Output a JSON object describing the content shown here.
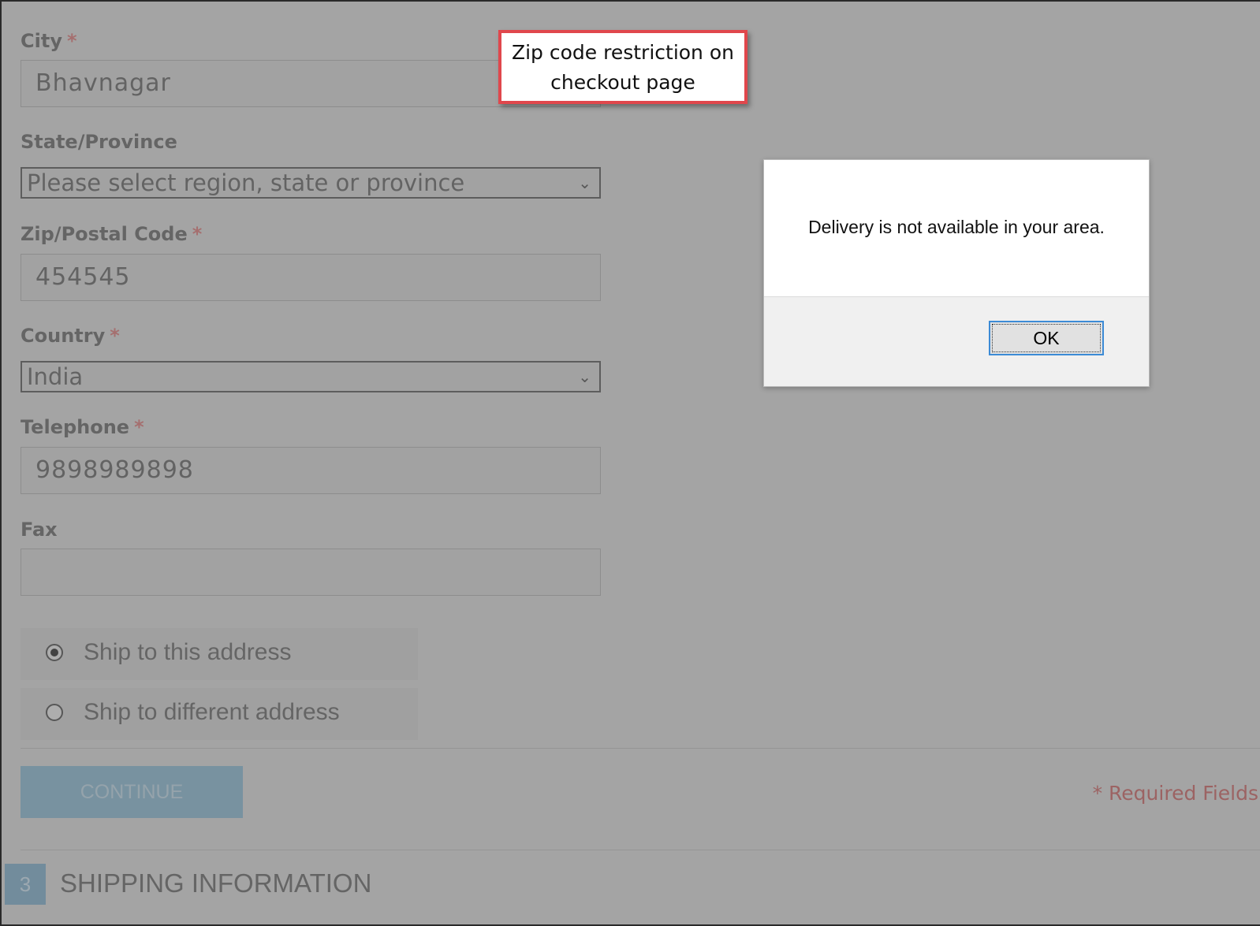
{
  "form": {
    "city": {
      "label": "City",
      "required_mark": "*",
      "value": "Bhavnagar"
    },
    "state": {
      "label": "State/Province",
      "selected": "Please select region, state or province"
    },
    "zip": {
      "label": "Zip/Postal Code",
      "required_mark": "*",
      "value": "454545"
    },
    "country": {
      "label": "Country",
      "required_mark": "*",
      "selected": "India"
    },
    "telephone": {
      "label": "Telephone",
      "required_mark": "*",
      "value": "9898989898"
    },
    "fax": {
      "label": "Fax",
      "value": ""
    },
    "shipping_options": [
      {
        "label": "Ship to this address",
        "checked": true
      },
      {
        "label": "Ship to different address",
        "checked": false
      }
    ],
    "continue_label": "CONTINUE",
    "required_note": "* Required Fields"
  },
  "next_step": {
    "number": "3",
    "title": "SHIPPING INFORMATION"
  },
  "alert": {
    "message": "Delivery is not available in your area.",
    "ok_label": "OK"
  },
  "callout": {
    "line1": "Zip code restriction on",
    "line2": "checkout page"
  },
  "colors": {
    "callout_border": "#e0474c",
    "ok_focus": "#3c8bd6",
    "button_blue": "#8db7cf",
    "required_red": "#c86a6a"
  }
}
